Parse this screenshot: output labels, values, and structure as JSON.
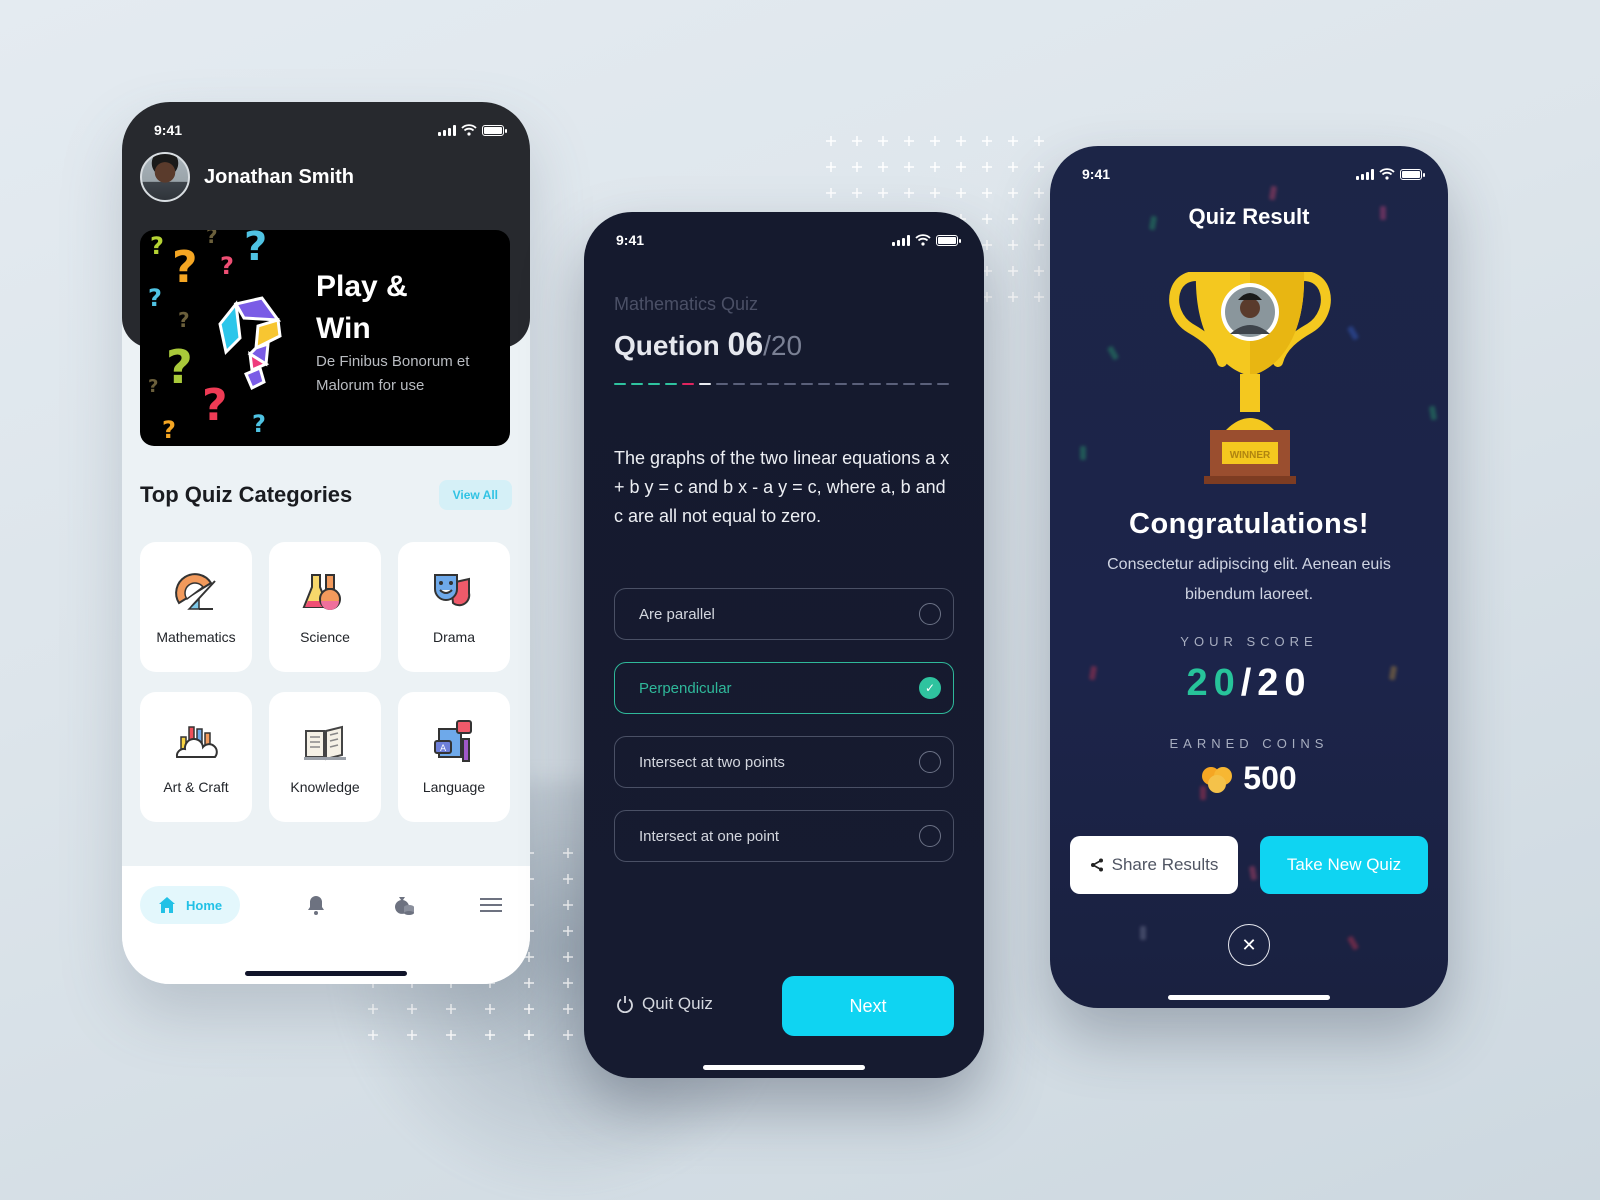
{
  "colors": {
    "accent_cyan": "#0fd4f2",
    "correct_green": "#2fc39f",
    "wrong_red": "#e0245e",
    "dark_navy": "#151a2e",
    "result_navy": "#1c2547",
    "home_dark": "#27292e"
  },
  "home": {
    "status_time": "9:41",
    "user_name": "Jonathan Smith",
    "banner": {
      "title_line1": "Play &",
      "title_line2": "Win",
      "subtitle": "De Finibus Bonorum et Malorum for use"
    },
    "section_title": "Top Quiz Categories",
    "view_all_label": "View All",
    "categories": [
      {
        "label": "Mathematics",
        "icon": "protractor-icon"
      },
      {
        "label": "Science",
        "icon": "flasks-icon"
      },
      {
        "label": "Drama",
        "icon": "theater-masks-icon"
      },
      {
        "label": "Art & Craft",
        "icon": "art-supplies-icon"
      },
      {
        "label": "Knowledge",
        "icon": "open-book-icon"
      },
      {
        "label": "Language",
        "icon": "language-books-icon"
      }
    ],
    "nav": {
      "home_label": "Home",
      "items": [
        "home-icon",
        "bell-icon",
        "money-bag-icon",
        "menu-icon"
      ]
    }
  },
  "quiz": {
    "status_time": "9:41",
    "quiz_name": "Mathematics Quiz",
    "question_label": "Quetion",
    "question_number": "06",
    "question_total": "/20",
    "progress": {
      "total": 20,
      "states": [
        "correct",
        "correct",
        "correct",
        "correct",
        "wrong",
        "current",
        "pending",
        "pending",
        "pending",
        "pending",
        "pending",
        "pending",
        "pending",
        "pending",
        "pending",
        "pending",
        "pending",
        "pending",
        "pending",
        "pending"
      ]
    },
    "question_text": "The graphs of the two linear equations a x + b y = c and b x - a y = c, where a, b and c are all not equal to zero.",
    "options": [
      {
        "label": "Are parallel",
        "selected": false
      },
      {
        "label": "Perpendicular",
        "selected": true
      },
      {
        "label": "Intersect at two points",
        "selected": false
      },
      {
        "label": "Intersect at one point",
        "selected": false
      }
    ],
    "quit_label": "Quit Quiz",
    "next_label": "Next"
  },
  "result": {
    "status_time": "9:41",
    "title": "Quiz Result",
    "trophy_plate": "WINNER",
    "congrats": "Congratulations!",
    "message": "Consectetur adipiscing elit. Aenean euis bibendum laoreet.",
    "score_label": "YOUR SCORE",
    "score_value": "20",
    "score_total": "/20",
    "coins_label": "EARNED COINS",
    "coins_value": "500",
    "share_label": "Share Results",
    "take_new_label": "Take New Quiz",
    "close_symbol": "✕"
  }
}
